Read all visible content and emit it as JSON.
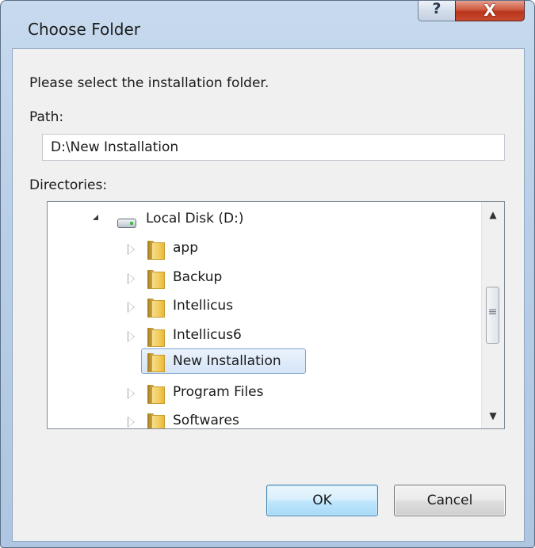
{
  "window": {
    "title": "Choose Folder",
    "help_label": "?",
    "close_label": "X"
  },
  "dialog": {
    "prompt": "Please select the installation folder.",
    "path_label": "Path:",
    "path_value": "D:\\New Installation",
    "directories_label": "Directories:"
  },
  "tree": {
    "root": {
      "label": "Local Disk (D:)",
      "icon": "drive-icon",
      "expanded": true
    },
    "items": [
      {
        "label": "app",
        "icon": "folder-icon",
        "has_children": true
      },
      {
        "label": "Backup",
        "icon": "folder-icon",
        "has_children": true
      },
      {
        "label": "Intellicus",
        "icon": "folder-icon",
        "has_children": true
      },
      {
        "label": "Intellicus6",
        "icon": "folder-icon",
        "has_children": true
      },
      {
        "label": "New Installation",
        "icon": "folder-icon",
        "has_children": false,
        "selected": true
      },
      {
        "label": "Program Files",
        "icon": "folder-icon",
        "has_children": true
      },
      {
        "label": "Softwares",
        "icon": "folder-icon",
        "has_children": true
      }
    ],
    "scrollbar": {
      "up_glyph": "▲",
      "down_glyph": "▼",
      "thumb_glyph": "≡"
    }
  },
  "buttons": {
    "ok_label": "OK",
    "cancel_label": "Cancel"
  },
  "colors": {
    "titlebar": "#b9cfe7",
    "close_button": "#c64a2f",
    "selection": "#d6e5f7",
    "ok_border": "#3c7fb1"
  }
}
